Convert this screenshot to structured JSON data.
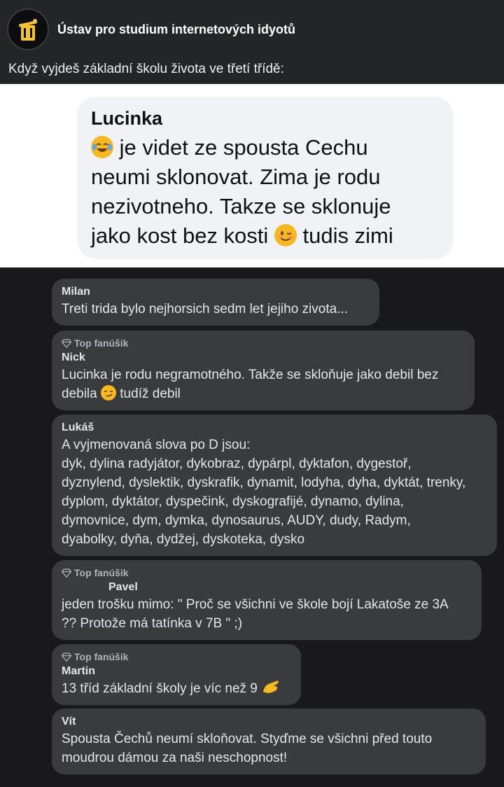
{
  "post": {
    "page_name": "Ústav pro studium internetových idyotů",
    "text": "Když vyjdeš základní školu života ve třetí třídě:",
    "avatar_icon": "trash-bin-icon"
  },
  "image_message": {
    "name": "Lucinka",
    "line1": "je videt ze spousta Cechu",
    "line2": "neumi sklonovat. Zima je rodu",
    "line3": "nezivotneho. Takze se sklonuje",
    "line4_a": "jako kost bez kosti",
    "line4_b": "tudis zimi",
    "emoji1": "laughing-tears-emoji",
    "emoji2": "winking-face-emoji"
  },
  "comments": [
    {
      "badge": "",
      "name": "Milan",
      "text": "Treti trida bylo nejhorsich sedm let jejiho zivota..."
    },
    {
      "badge": "Top fanúšik",
      "name": "Nick",
      "text_a": "Lucinka je rodu negramotného. Takže se skloňuje jako debil bez\ndebila",
      "text_b": "tudíž debil",
      "emoji": "smirking-face-emoji"
    },
    {
      "badge": "",
      "name": "Lukáš",
      "text": "A vyjmenovaná slova po D jsou:\ndyk, dylina radyjátor, dykobraz, dypárpl, dyktafon, dygestoř,\ndyznylend, dyslektik, dyskrafik, dynamit, lodyha, dyha, dyktát, trenky,\ndyplom, dyktátor, dyspečink, dyskografijé, dynamo, dylina,\ndymovnice, dym, dymka, dynosaurus, AUDY, dudy, Radym,\ndyabolky, dyňa, dydžej, dyskoteka, dysko"
    },
    {
      "badge": "Top fanúšik",
      "name": "Pavel",
      "text": "jeden trošku mimo: \" Proč se všichni ve škole bojí Lakatoše ze 3A\n?? Protože má tatínka v 7B \" ;)"
    },
    {
      "badge": "Top fanúšik",
      "name": "Martin",
      "text": "13 tříd základní školy je víc než 9",
      "emoji": "pinching-hand-emoji"
    },
    {
      "badge": "",
      "name": "Vít",
      "text": "Spousta Čechů neumí skloňovat. Styďme se všichni před touto\nmoudrou dámou za naši neschopnost!"
    }
  ],
  "colors": {
    "background": "#19191b",
    "header": "#242527",
    "comment_bubble": "#3a3b3c",
    "badge_text": "#b0b3b8"
  }
}
